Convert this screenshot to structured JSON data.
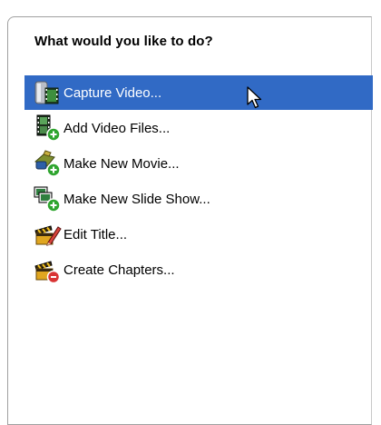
{
  "panel": {
    "heading": "What would you like to do?"
  },
  "tasks": [
    {
      "label": "Capture Video...",
      "icon": "camera-film-icon",
      "selected": true
    },
    {
      "label": "Add Video Files...",
      "icon": "film-add-icon",
      "selected": false
    },
    {
      "label": "Make New Movie...",
      "icon": "movie-add-icon",
      "selected": false
    },
    {
      "label": "Make New Slide Show...",
      "icon": "slideshow-add-icon",
      "selected": false
    },
    {
      "label": "Edit Title...",
      "icon": "clapper-pencil-icon",
      "selected": false
    },
    {
      "label": "Create Chapters...",
      "icon": "clapper-chapter-icon",
      "selected": false
    }
  ],
  "colors": {
    "selection": "#316ac5",
    "selection_text": "#ffffff",
    "add_badge": "#2fa52f",
    "chapter_badge": "#d93434"
  }
}
